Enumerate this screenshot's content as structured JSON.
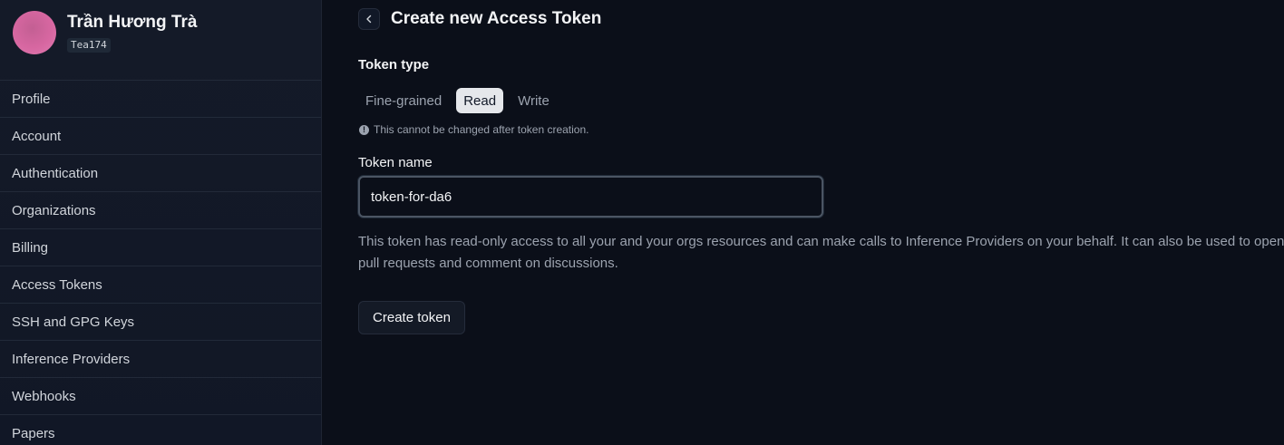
{
  "user": {
    "name": "Trần Hương Trà",
    "handle": "Tea174"
  },
  "sidebar": {
    "items": [
      {
        "label": "Profile"
      },
      {
        "label": "Account"
      },
      {
        "label": "Authentication"
      },
      {
        "label": "Organizations"
      },
      {
        "label": "Billing"
      },
      {
        "label": "Access Tokens"
      },
      {
        "label": "SSH and GPG Keys"
      },
      {
        "label": "Inference Providers"
      },
      {
        "label": "Webhooks"
      },
      {
        "label": "Papers"
      }
    ]
  },
  "header": {
    "back_icon": "chevron-left-icon",
    "title": "Create new Access Token"
  },
  "token_type": {
    "label": "Token type",
    "options": [
      "Fine-grained",
      "Read",
      "Write"
    ],
    "selected": "Read",
    "hint": "This cannot be changed after token creation."
  },
  "token_name": {
    "label": "Token name",
    "value": "token-for-da6"
  },
  "description": "This token has read-only access to all your and your orgs resources and can make calls to Inference Providers on your behalf. It can also be used to open pull requests and comment on discussions.",
  "actions": {
    "create_label": "Create token"
  }
}
